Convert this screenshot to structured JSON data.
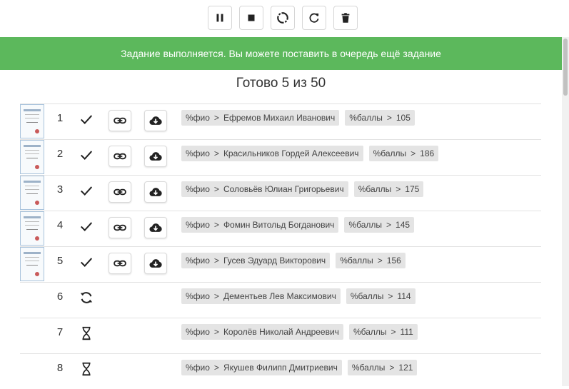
{
  "toolbar": {
    "buttons": [
      {
        "icon": "pause-icon"
      },
      {
        "icon": "stop-icon"
      },
      {
        "icon": "spinner-icon"
      },
      {
        "icon": "refresh-icon"
      },
      {
        "icon": "trash-icon"
      }
    ]
  },
  "banner": {
    "text": "Задание выполняется. Вы можете поставить в очередь ещё задание",
    "color": "#5cb85c"
  },
  "progress": {
    "title": "Готово 5 из 50"
  },
  "rows": [
    {
      "num": "1",
      "status": "done",
      "has_thumb": true,
      "name_key": "%фио",
      "name_sep": ">",
      "name": "Ефремов Михаил Иванович",
      "score_key": "%баллы",
      "score_sep": ">",
      "score": "105"
    },
    {
      "num": "2",
      "status": "done",
      "has_thumb": true,
      "name_key": "%фио",
      "name_sep": ">",
      "name": "Красильников Гордей Алексеевич",
      "score_key": "%баллы",
      "score_sep": ">",
      "score": "186"
    },
    {
      "num": "3",
      "status": "done",
      "has_thumb": true,
      "name_key": "%фио",
      "name_sep": ">",
      "name": "Соловьёв Юлиан Григорьевич",
      "score_key": "%баллы",
      "score_sep": ">",
      "score": "175"
    },
    {
      "num": "4",
      "status": "done",
      "has_thumb": true,
      "name_key": "%фио",
      "name_sep": ">",
      "name": "Фомин Витольд Богданович",
      "score_key": "%баллы",
      "score_sep": ">",
      "score": "145"
    },
    {
      "num": "5",
      "status": "done",
      "has_thumb": true,
      "name_key": "%фио",
      "name_sep": ">",
      "name": "Гусев Эдуард Викторович",
      "score_key": "%баллы",
      "score_sep": ">",
      "score": "156"
    },
    {
      "num": "6",
      "status": "processing",
      "has_thumb": false,
      "name_key": "%фио",
      "name_sep": ">",
      "name": "Дементьев Лев Максимович",
      "score_key": "%баллы",
      "score_sep": ">",
      "score": "114"
    },
    {
      "num": "7",
      "status": "waiting",
      "has_thumb": false,
      "name_key": "%фио",
      "name_sep": ">",
      "name": "Королёв Николай Андреевич",
      "score_key": "%баллы",
      "score_sep": ">",
      "score": "111"
    },
    {
      "num": "8",
      "status": "waiting",
      "has_thumb": false,
      "name_key": "%фио",
      "name_sep": ">",
      "name": "Якушев Филипп Дмитриевич",
      "score_key": "%баллы",
      "score_sep": ">",
      "score": "121"
    }
  ]
}
